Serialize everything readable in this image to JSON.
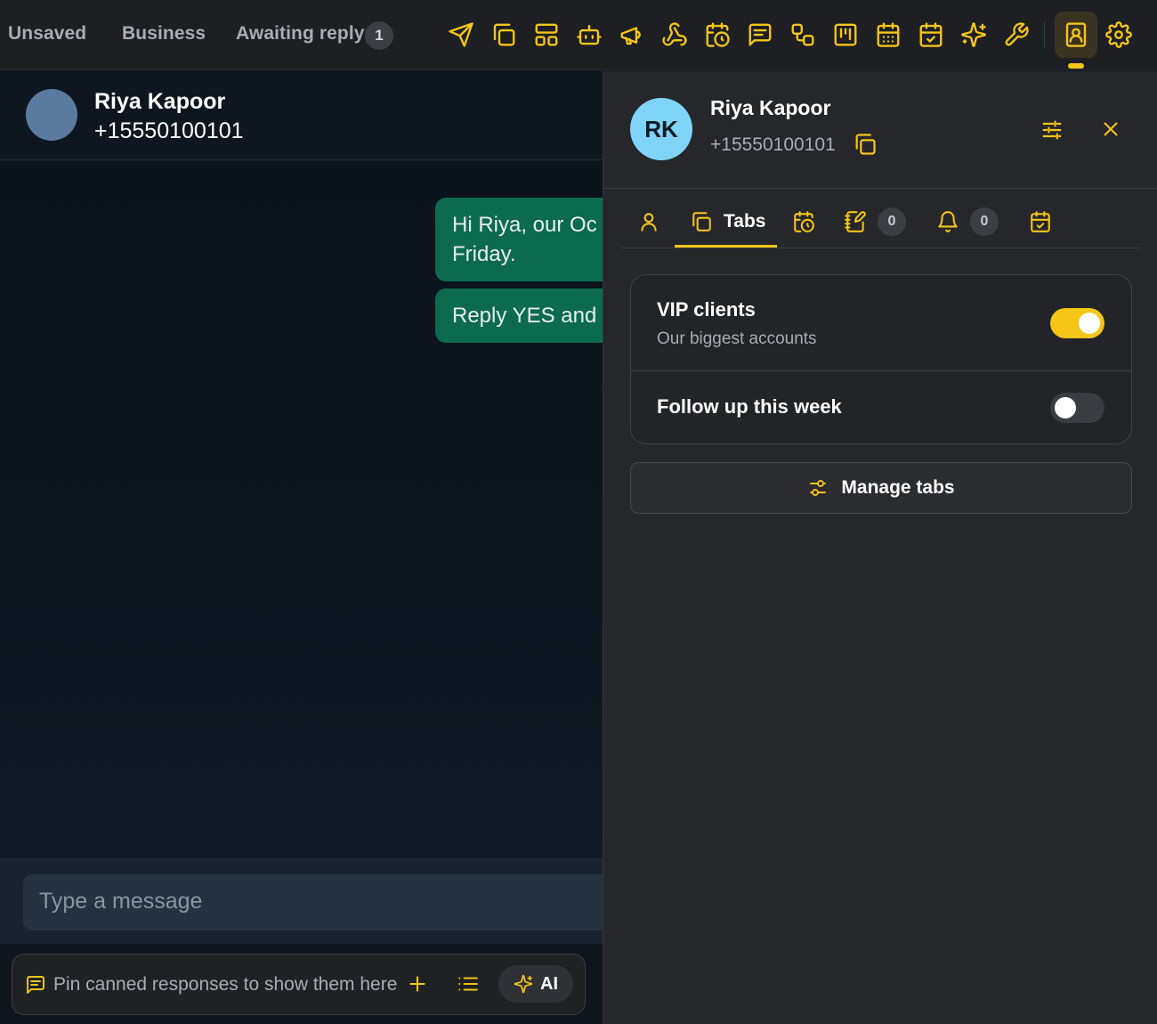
{
  "topbar": {
    "filters": [
      {
        "label": "Unsaved"
      },
      {
        "label": "Business"
      },
      {
        "label": "Awaiting reply",
        "count": "1"
      }
    ],
    "icons": [
      "send-icon",
      "tabs-icon",
      "layout-icon",
      "bot-icon",
      "megaphone-icon",
      "webhook-icon",
      "scheduled-icon",
      "message-square-icon",
      "workflow-icon",
      "kanban-icon",
      "calendar-icon",
      "calendar-check-icon",
      "sparkles-icon",
      "wrench-icon",
      "contact-card-icon",
      "settings-icon"
    ],
    "active_icon": "contact-card-icon",
    "accent": "#f5c518"
  },
  "chat": {
    "contact_name": "Riya Kapoor",
    "contact_phone": "+15550100101",
    "messages": [
      {
        "text_line1": "Hi Riya, our Oc",
        "text_line2": "Friday."
      },
      {
        "text_line1": "Reply YES and v"
      }
    ],
    "composer_placeholder": "Type a message",
    "canned_text": "Pin canned responses to show them here",
    "ai_label": "AI",
    "bubble_color": "#0c6b4f"
  },
  "panel": {
    "initials": "RK",
    "name": "Riya Kapoor",
    "phone": "+15550100101",
    "avatar_color": "#7fd4f7",
    "tabs": [
      {
        "icon": "user-icon",
        "label": ""
      },
      {
        "icon": "tabs-icon",
        "label": "Tabs",
        "active": true
      },
      {
        "icon": "scheduled-icon",
        "label": ""
      },
      {
        "icon": "notes-icon",
        "label": "",
        "count": "0"
      },
      {
        "icon": "bell-icon",
        "label": "",
        "count": "0"
      },
      {
        "icon": "calendar-check-icon",
        "label": ""
      }
    ],
    "tab_list": [
      {
        "title": "VIP clients",
        "subtitle": "Our biggest accounts",
        "enabled": true
      },
      {
        "title": "Follow up this week",
        "subtitle": "",
        "enabled": false
      }
    ],
    "manage_label": "Manage tabs"
  }
}
